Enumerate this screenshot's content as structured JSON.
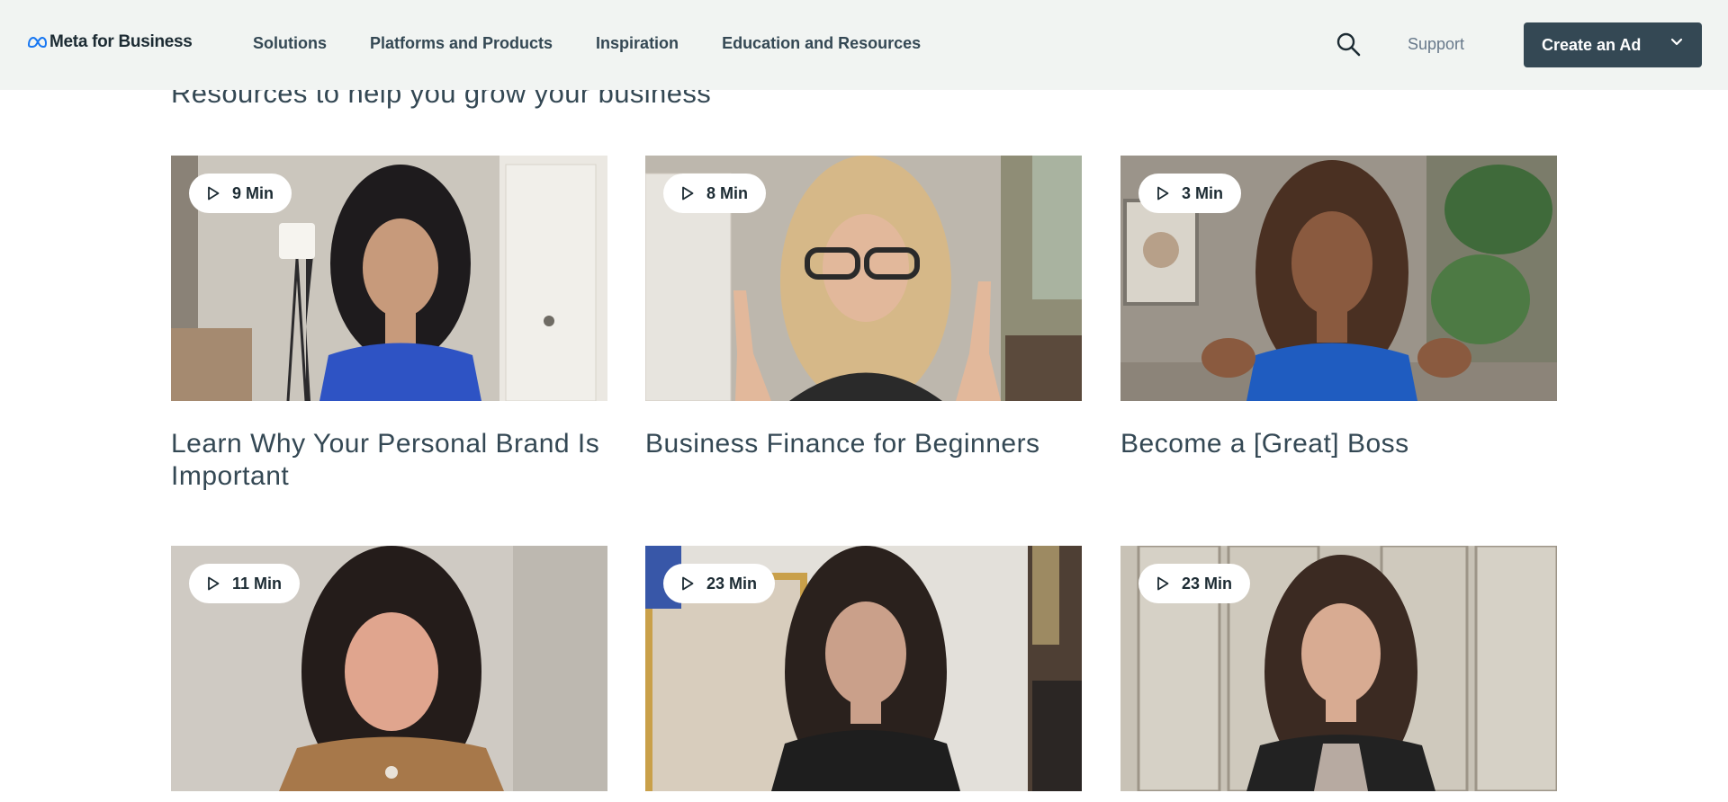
{
  "header": {
    "logo_text": "Meta for Business",
    "nav": [
      "Solutions",
      "Platforms and Products",
      "Inspiration",
      "Education and Resources"
    ],
    "support_label": "Support",
    "cta_label": "Create an Ad",
    "icons": {
      "search": "search-icon",
      "chevron": "chevron-down-icon",
      "logo": "meta-infinity-logo"
    }
  },
  "section": {
    "title": "Resources to help you grow your business"
  },
  "cards": [
    {
      "duration": "9 Min",
      "title": "Learn Why Your Personal Brand Is Important",
      "palette": [
        "#c9c3ba",
        "#2b2a2c",
        "#2e53c4"
      ]
    },
    {
      "duration": "8 Min",
      "title": "Business Finance for Beginners",
      "palette": [
        "#b9b3a8",
        "#d8b98a",
        "#2a2a2a"
      ]
    },
    {
      "duration": "3 Min",
      "title": "Become a [Great] Boss",
      "palette": [
        "#9c958b",
        "#4a3022",
        "#1f5cc0"
      ]
    },
    {
      "duration": "11 Min",
      "title": "",
      "palette": [
        "#cfcac3",
        "#241c1a",
        "#a7784a"
      ]
    },
    {
      "duration": "23 Min",
      "title": "",
      "palette": [
        "#e3e0da",
        "#2a211d",
        "#1e1e1e"
      ]
    },
    {
      "duration": "23 Min",
      "title": "",
      "palette": [
        "#c8c2b6",
        "#3b2a22",
        "#222222"
      ]
    }
  ],
  "colors": {
    "header_bg": "#f1f4f2",
    "cta_bg": "#344854",
    "text": "#344854"
  }
}
